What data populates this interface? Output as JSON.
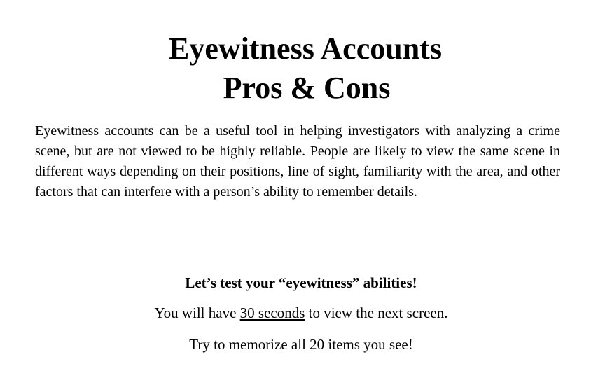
{
  "slide": {
    "title": {
      "line1": "Eyewitness Accounts",
      "line2": "Pros & Cons"
    },
    "paragraph": "Eyewitness accounts can be a useful tool in helping investigators with analyzing a crime scene, but are not viewed to be highly reliable.  People are likely to view the same scene in different ways depending on their positions, line of sight, familiarity with the area, and other factors that can interfere with a person’s ability to remember details.",
    "call_to_action": "Let’s test your “eyewitness” abilities!",
    "instruction": {
      "prefix": "You will have ",
      "emphasis": "30 seconds",
      "suffix": " to view the next screen."
    },
    "memorize": "Try to memorize all 20 items you see!"
  }
}
